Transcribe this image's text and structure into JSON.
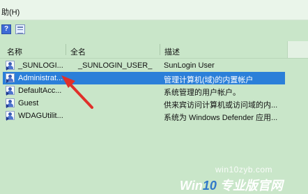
{
  "menu": {
    "help": "助(H)"
  },
  "toolbar": {
    "help_icon_label": "?"
  },
  "columns": {
    "name": "名称",
    "fullname": "全名",
    "description": "描述"
  },
  "rows": [
    {
      "name": "_SUNLOGI...",
      "fullname": "_SUNLOGIN_USER_",
      "description": "SunLogin User"
    },
    {
      "name": "Administrat...",
      "fullname": "",
      "description": "管理计算机(域)的内置帐户"
    },
    {
      "name": "DefaultAcc...",
      "fullname": "",
      "description": "系统管理的用户帐户。"
    },
    {
      "name": "Guest",
      "fullname": "",
      "description": "供来宾访问计算机或访问域的内..."
    },
    {
      "name": "WDAGUtilit...",
      "fullname": "",
      "description": "系统为 Windows Defender 应用..."
    }
  ],
  "watermark": {
    "url": "win10zyb.com",
    "brand_prefix": "Win",
    "brand_number": "10",
    "brand_suffix": " 专业版官网"
  },
  "colors": {
    "selection": "#2b7fd9",
    "background": "#c9e6c9",
    "annotation": "#e0302a"
  }
}
